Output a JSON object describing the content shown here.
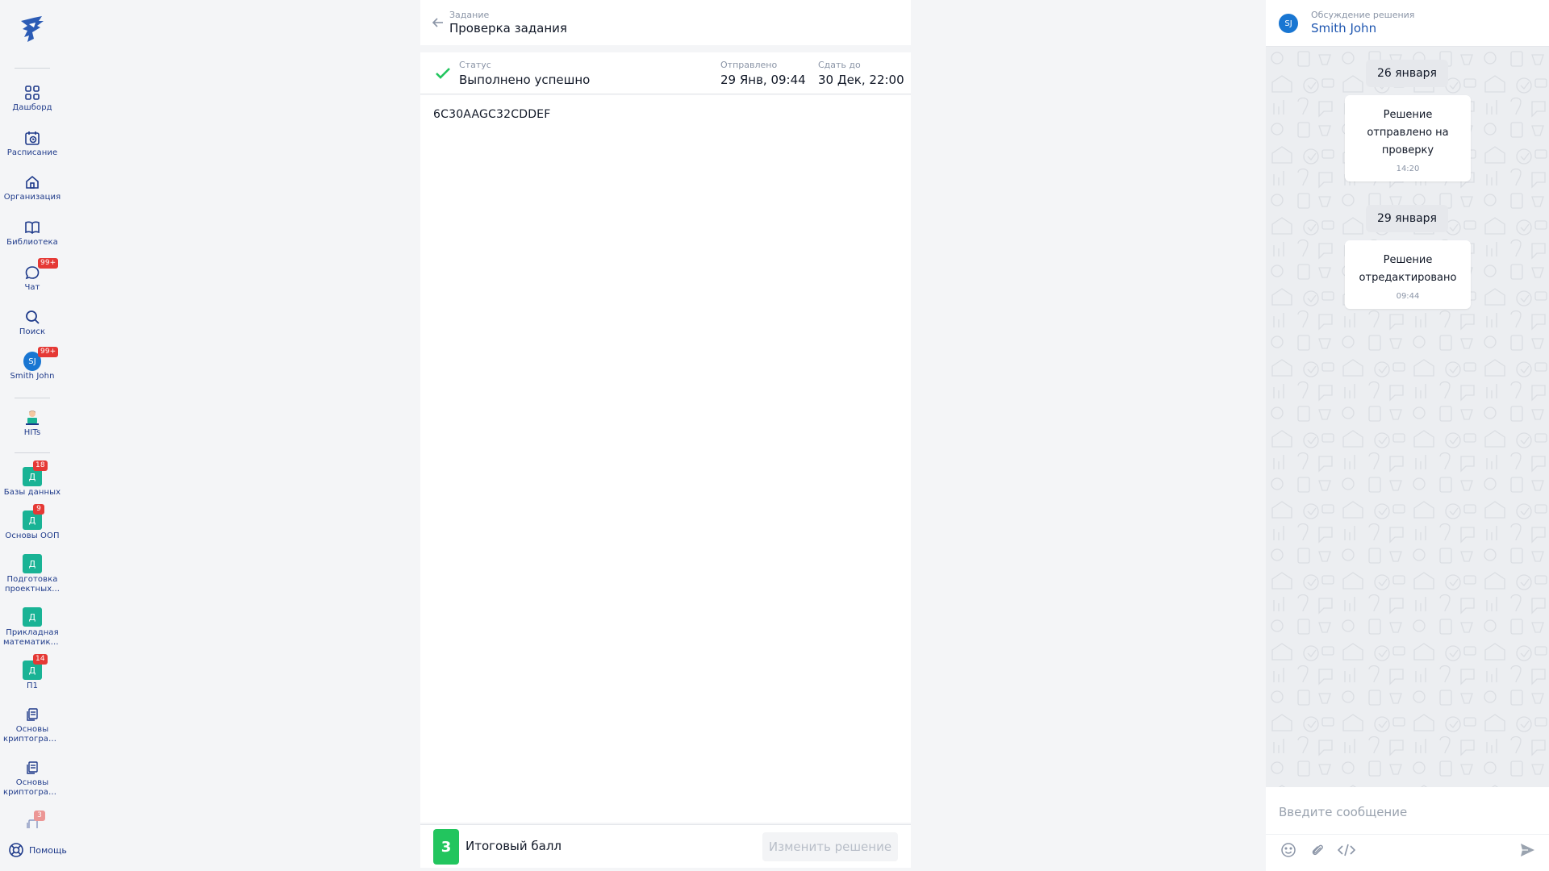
{
  "sidebar": {
    "nav": [
      {
        "label": "Дашборд",
        "icon": "grid-icon"
      },
      {
        "label": "Расписание",
        "icon": "calendar-icon"
      },
      {
        "label": "Организация",
        "icon": "home-icon"
      },
      {
        "label": "Библиотека",
        "icon": "book-icon"
      },
      {
        "label": "Чат",
        "icon": "chat-icon",
        "badge": "99+"
      },
      {
        "label": "Поиск",
        "icon": "search-icon"
      },
      {
        "label": "Smith John",
        "avatar": "SJ",
        "badge": "99+"
      }
    ],
    "hits": {
      "label": "HITs"
    },
    "courses": [
      {
        "letter": "Д",
        "label": "Базы данных",
        "badge": "18"
      },
      {
        "letter": "Д",
        "label": "Основы ООП",
        "badge": "9"
      },
      {
        "letter": "Д",
        "label": "Подготовка проектных..."
      },
      {
        "letter": "Д",
        "label": "Прикладная математика..."
      },
      {
        "letter": "Д",
        "label": "П1",
        "badge": "14"
      },
      {
        "label": "Основы криптограф..."
      },
      {
        "label": "Основы криптограф..."
      },
      {
        "badge": "3"
      }
    ],
    "help_label": "Помощь"
  },
  "task": {
    "header_sub": "Задание",
    "header_title": "Проверка задания",
    "status_key": "Статус",
    "status_value": "Выполнено успешно",
    "sent_key": "Отправлено",
    "sent_value": "29 Янв, 09:44",
    "due_key": "Сдать до",
    "due_value": "30 Дек, 22:00",
    "answer": "6C30AAGC32CDDEF",
    "score": "3",
    "score_label": "Итоговый балл",
    "edit_button": "Изменить решение"
  },
  "chat": {
    "header_sub": "Обсуждение решения",
    "header_name": "Smith John",
    "avatar": "SJ",
    "messages": [
      {
        "date": "26 января",
        "text": "Решение отправлено на проверку",
        "time": "14:20"
      },
      {
        "date": "29 января",
        "text": "Решение отредактировано",
        "time": "09:44"
      }
    ],
    "input_placeholder": "Введите сообщение"
  },
  "colors": {
    "accent": "#1e56b0",
    "course": "#19b395",
    "success": "#22c55e",
    "badge": "#e53935"
  }
}
